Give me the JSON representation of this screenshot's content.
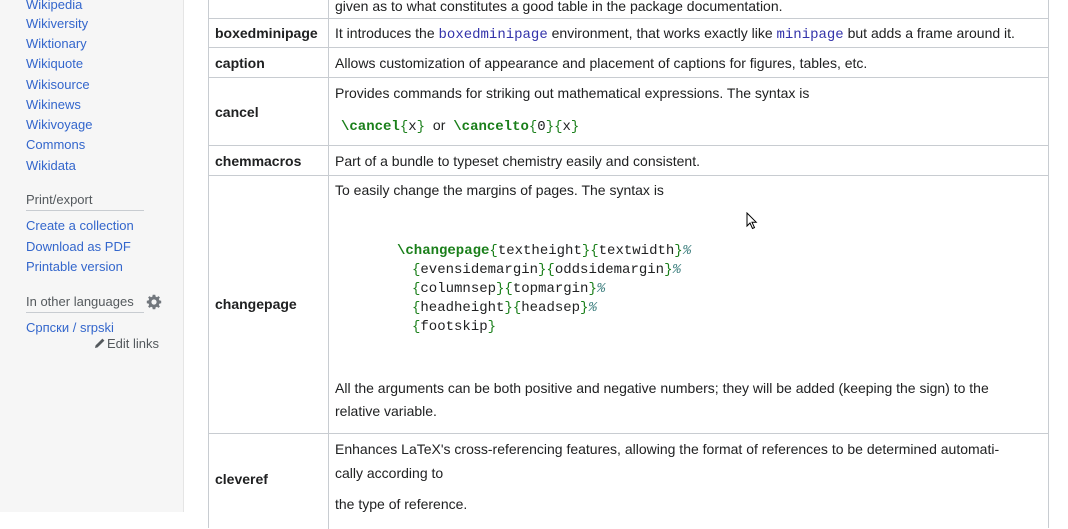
{
  "sidebar": {
    "project_links": [
      "Wikipedia",
      "Wikiversity",
      "Wiktionary",
      "Wikiquote",
      "Wikisource",
      "Wikinews",
      "Wikivoyage",
      "Commons",
      "Wikidata"
    ],
    "print_export_heading": "Print/export",
    "print_export_links": [
      "Create a collection",
      "Download as PDF",
      "Printable version"
    ],
    "languages_heading": "In other languages",
    "language_links": [
      "Српски / srpski"
    ],
    "edit_links_label": "Edit links"
  },
  "table": {
    "top_fragment": "given as to what constitutes a good table in the package documentation.",
    "rows": {
      "boxedminipage": {
        "name": "boxedminipage",
        "desc_before": "It introduces the ",
        "code1": "boxedminipage",
        "desc_middle": " environment, that works exactly like ",
        "code2": "minipage",
        "desc_after": " but adds a frame around it."
      },
      "caption": {
        "name": "caption",
        "desc": "Allows customization of appearance and placement of captions for figures, tables, etc."
      },
      "cancel": {
        "name": "cancel",
        "desc": "Provides commands for striking out mathematical expressions. The syntax is",
        "cmd1": "\\cancel",
        "arg1": "x",
        "joiner": "or",
        "cmd2": "\\cancelto",
        "arg2a": "0",
        "arg2b": "x"
      },
      "chemmacros": {
        "name": "chemmacros",
        "desc": "Part of a bundle to typeset chemistry easily and consistent."
      },
      "changepage": {
        "name": "changepage",
        "desc": "To easily change the margins of pages. The syntax is",
        "cmd": "\\changepage",
        "line1_args": [
          "textheight",
          "textwidth"
        ],
        "line2_args": [
          "evensidemargin",
          "oddsidemargin"
        ],
        "line3_args": [
          "columnsep",
          "topmargin"
        ],
        "line4_args": [
          "headheight",
          "headsep"
        ],
        "line5_args": [
          "footskip"
        ],
        "comment_char": "%",
        "note_line1": "All the arguments can be both positive and negative numbers; they will be added (keeping the sign) to the",
        "note_line2": "relative variable."
      },
      "cleveref": {
        "name": "cleveref",
        "desc_line1": "Enhances LaTeX's cross-referencing features, allowing the format of references to be determined automati-",
        "desc_line2": "cally according to",
        "desc_line3": "the type of reference."
      }
    }
  },
  "colors": {
    "link": "#3366cc",
    "keyword": "#1a7f1a",
    "code": "#3333aa",
    "comment": "#408080",
    "border": "#c8ccd1",
    "sidebar_bg": "#f6f6f6"
  },
  "icons": {
    "settings": "gear-icon",
    "edit": "pencil-icon",
    "pointer": "mouse-cursor-icon"
  }
}
